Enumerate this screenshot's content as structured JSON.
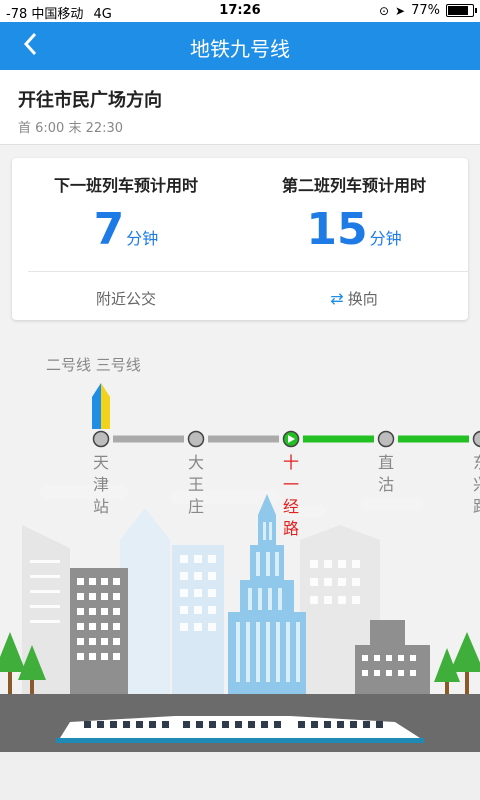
{
  "status_bar": {
    "signal": "-78",
    "carrier": "中国移动",
    "network": "4G",
    "time": "17:26",
    "battery": "77%"
  },
  "nav": {
    "back_icon": "chevron-left-icon",
    "title": "地铁九号线"
  },
  "direction": {
    "label": "开往市民广场方向",
    "hours": "首 6:00 末 22:30"
  },
  "arrival": {
    "next": {
      "label": "下一班列车预计用时",
      "value": "7",
      "unit": "分钟"
    },
    "second": {
      "label": "第二班列车预计用时",
      "value": "15",
      "unit": "分钟"
    },
    "nearby_bus": "附近公交",
    "switch_direction": "换向",
    "accent_color": "#1e7be6"
  },
  "transfer_lines": "二号线 三号线",
  "line_map": {
    "passed_color": "#aaaaaa",
    "upcoming_color": "#22c022",
    "current_color": "#e21f1f",
    "stations": [
      {
        "name": "天津站",
        "chars": [
          "天",
          "津",
          "站"
        ],
        "state": "passed"
      },
      {
        "name": "大王庄",
        "chars": [
          "大",
          "王",
          "庄"
        ],
        "state": "passed"
      },
      {
        "name": "十一经路",
        "chars": [
          "十",
          "一",
          "经",
          "路"
        ],
        "state": "current"
      },
      {
        "name": "直沽",
        "chars": [
          "直",
          "沽"
        ],
        "state": "upcoming"
      },
      {
        "name": "东兴路",
        "chars": [
          "东",
          "兴",
          "路"
        ],
        "state": "upcoming"
      }
    ]
  }
}
